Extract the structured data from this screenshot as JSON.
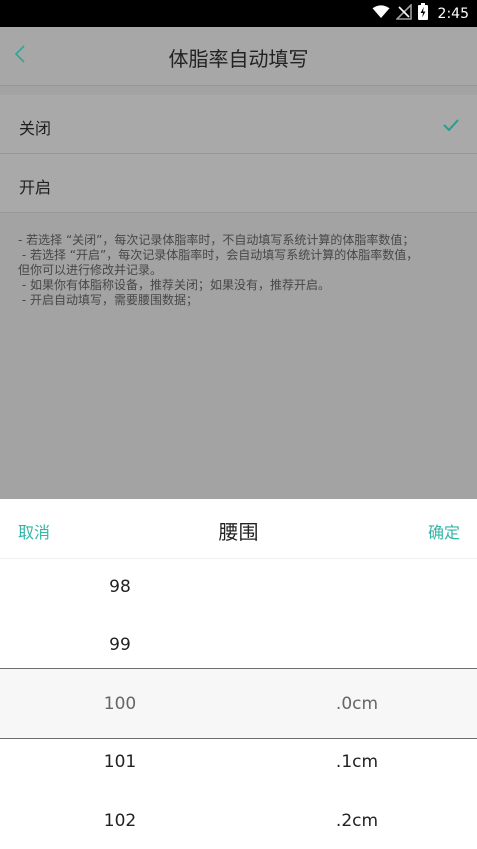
{
  "status_bar": {
    "time": "2:45",
    "icons": [
      "wifi-icon",
      "no-signal-icon",
      "battery-charging-icon"
    ]
  },
  "app_bar": {
    "title": "体脂率自动填写",
    "back_icon": "chevron-left-icon"
  },
  "options": [
    {
      "label": "关闭",
      "selected": true
    },
    {
      "label": "开启",
      "selected": false
    }
  ],
  "notes": {
    "line1": "- 若选择 “关闭”，每次记录体脂率时，不自动填写系统计算的体脂率数值；",
    "line2": " - 若选择 “开启”，每次记录体脂率时，会自动填写系统计算的体脂率数值，",
    "line3": "但你可以进行修改并记录。",
    "line4": " - 如果你有体脂称设备，推荐关闭；如果没有，推荐开启。",
    "line5": " - 开启自动填写，需要腰围数据；"
  },
  "sheet": {
    "cancel_label": "取消",
    "title": "腰围",
    "confirm_label": "确定"
  },
  "picker": {
    "left_items": [
      "98",
      "99",
      "100",
      "101",
      "102"
    ],
    "right_items": [
      ".0cm",
      ".1cm",
      ".2cm"
    ],
    "selected_left": "100",
    "selected_right": ".0cm"
  },
  "colors": {
    "accent": "#35b5a6"
  }
}
